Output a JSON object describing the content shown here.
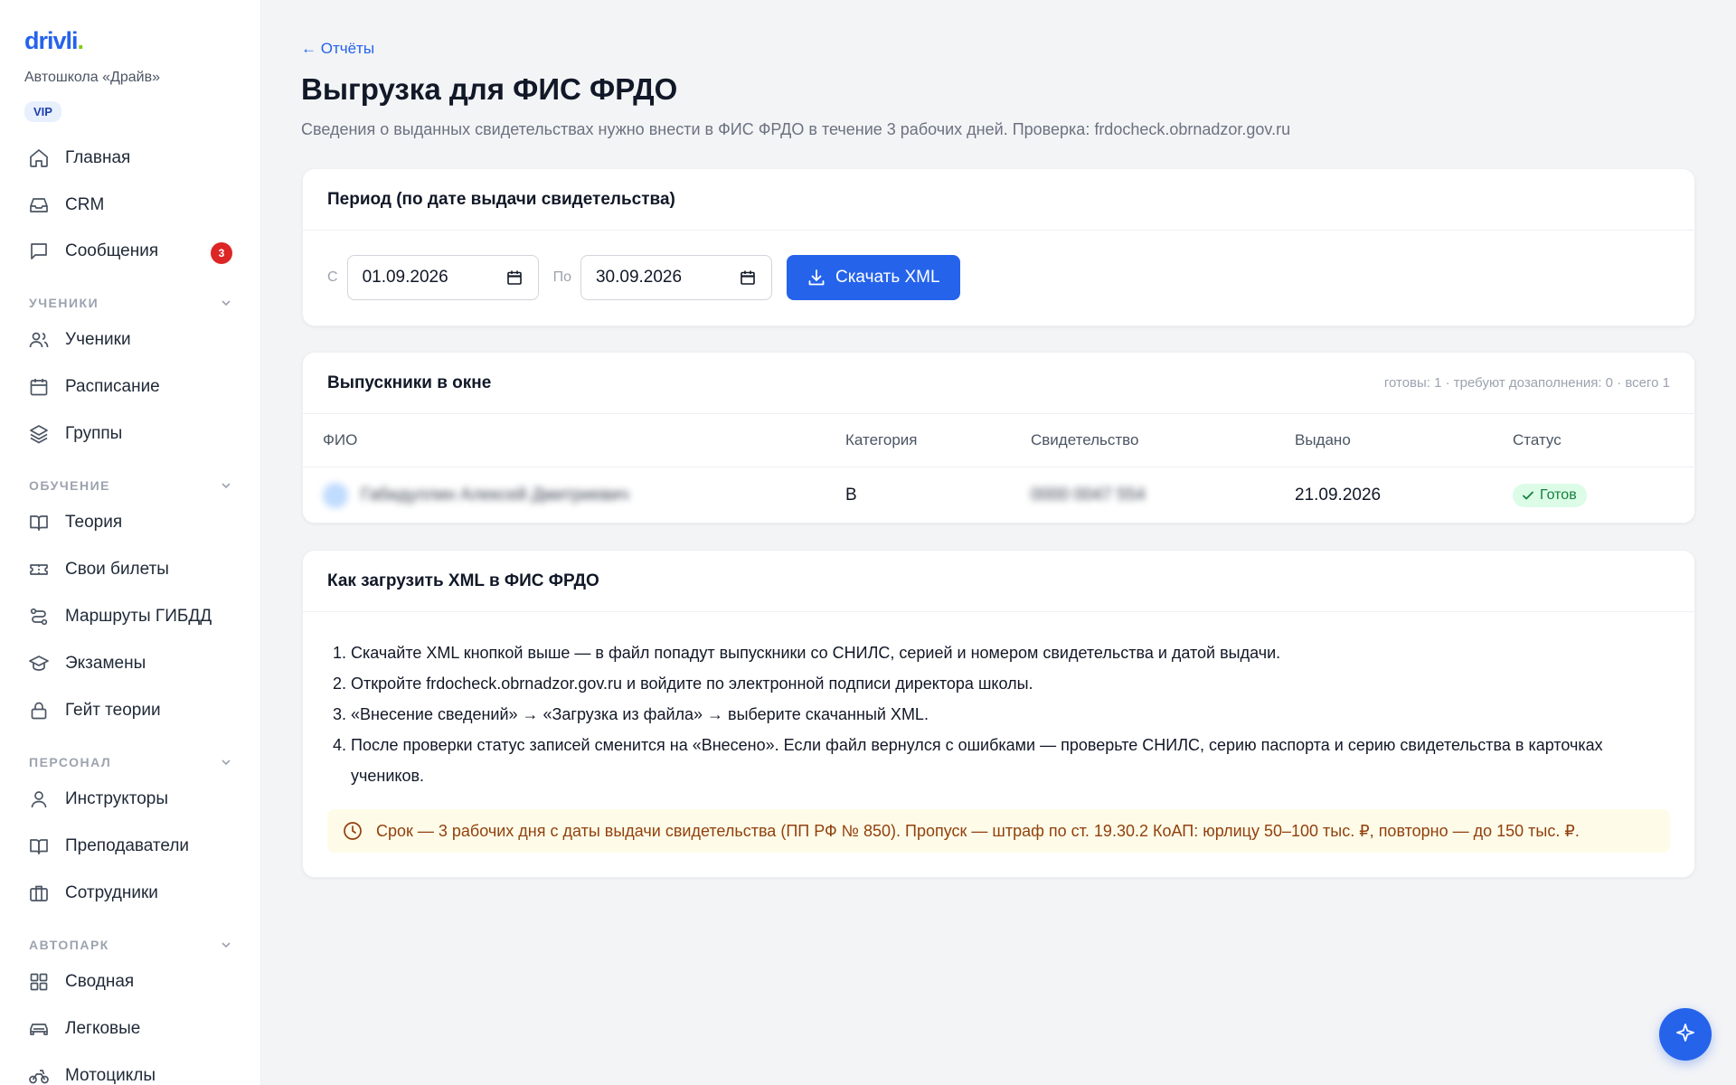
{
  "brand": {
    "logo_text": "drivli",
    "logo_dot": ".",
    "school": "Автошкола «Драйв»",
    "plan_badge": "VIP"
  },
  "sidebar": {
    "top_items": [
      {
        "label": "Главная",
        "icon": "home-icon"
      },
      {
        "label": "CRM",
        "icon": "inbox-icon"
      },
      {
        "label": "Сообщения",
        "icon": "message-icon",
        "badge": "3"
      }
    ],
    "sections": [
      {
        "title": "УЧЕНИКИ",
        "items": [
          {
            "label": "Ученики",
            "icon": "users-icon"
          },
          {
            "label": "Расписание",
            "icon": "calendar-icon"
          },
          {
            "label": "Группы",
            "icon": "layers-icon"
          }
        ]
      },
      {
        "title": "ОБУЧЕНИЕ",
        "items": [
          {
            "label": "Теория",
            "icon": "book-icon"
          },
          {
            "label": "Свои билеты",
            "icon": "ticket-icon"
          },
          {
            "label": "Маршруты ГИБДД",
            "icon": "route-icon"
          },
          {
            "label": "Экзамены",
            "icon": "graduation-cap-icon"
          },
          {
            "label": "Гейт теории",
            "icon": "lock-icon"
          }
        ]
      },
      {
        "title": "ПЕРСОНАЛ",
        "items": [
          {
            "label": "Инструкторы",
            "icon": "user-icon"
          },
          {
            "label": "Преподаватели",
            "icon": "book-open-icon"
          },
          {
            "label": "Сотрудники",
            "icon": "briefcase-icon"
          }
        ]
      },
      {
        "title": "АВТОПАРК",
        "items": [
          {
            "label": "Сводная",
            "icon": "grid-icon"
          },
          {
            "label": "Легковые",
            "icon": "car-icon"
          },
          {
            "label": "Мотоциклы",
            "icon": "motorcycle-icon"
          }
        ]
      }
    ]
  },
  "header": {
    "back_link": "← Отчёты",
    "title": "Выгрузка для ФИС ФРДО",
    "subtitle": "Сведения о выданных свидетельствах нужно внести в ФИС ФРДО в течение 3 рабочих дней. Проверка: frdocheck.obrnadzor.gov.ru"
  },
  "period": {
    "title": "Период (по дате выдачи свидетельства)",
    "from_label": "С",
    "from_value": "01.09.2026",
    "to_label": "По",
    "to_value": "30.09.2026",
    "download_label": "Скачать XML"
  },
  "graduates": {
    "title": "Выпускники в окне",
    "summary": "готовы: 1 · требуют дозаполнения: 0 · всего 1",
    "columns": [
      "ФИО",
      "Категория",
      "Свидетельство",
      "Выдано",
      "Статус"
    ],
    "rows": [
      {
        "name": "Габидуллин Алексей Дмитриевич",
        "category": "B",
        "certificate": "0000 0047 554",
        "issued": "21.09.2026",
        "status": "Готов"
      }
    ]
  },
  "instructions": {
    "title": "Как загрузить XML в ФИС ФРДО",
    "steps": [
      "Скачайте XML кнопкой выше — в файл попадут выпускники со СНИЛС, серией и номером свидетельства и датой выдачи.",
      "Откройте frdocheck.obrnadzor.gov.ru и войдите по электронной подписи директора школы.",
      "«Внесение сведений» → «Загрузка из файла» → выберите скачанный XML.",
      "После проверки статус записей сменится на «Внесено». Если файл вернулся с ошибками — проверьте СНИЛС, серию паспорта и серию свидетельства в карточках учеников."
    ],
    "notice": "Срок — 3 рабочих дня с даты выдачи свидетельства (ПП РФ № 850). Пропуск — штраф по ст. 19.30.2 КоАП: юрлицу 50–100 тыс. ₽, повторно — до 150 тыс. ₽."
  },
  "colors": {
    "accent": "#2563eb",
    "badge_red": "#dc2626",
    "success": "#15803d",
    "notice_bg": "#fefce8",
    "notice_text": "#92400e"
  }
}
